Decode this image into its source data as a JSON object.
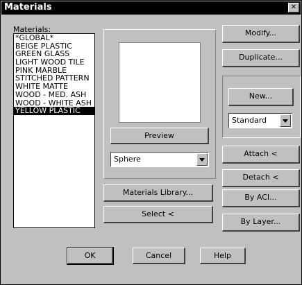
{
  "window": {
    "title": "Materials",
    "close_glyph": "✕"
  },
  "materials_label": "Materials:",
  "materials": [
    "*GLOBAL*",
    "BEIGE PLASTIC",
    "GREEN GLASS",
    "LIGHT WOOD TILE",
    "PINK MARBLE",
    "STITCHED PATTERN",
    "WHITE MATTE",
    "WOOD - MED. ASH",
    "WOOD - WHITE ASH",
    "YELLOW PLASTIC"
  ],
  "selected_material": "YELLOW PLASTIC",
  "preview": {
    "button_label": "Preview",
    "shape_value": "Sphere"
  },
  "buttons": {
    "materials_library": "Materials Library...",
    "select": "Select <",
    "modify": "Modify...",
    "duplicate": "Duplicate...",
    "new": "New...",
    "attach": "Attach <",
    "detach": "Detach <",
    "by_aci": "By ACI...",
    "by_layer": "By Layer...",
    "ok": "OK",
    "cancel": "Cancel",
    "help": "Help"
  },
  "new_type_value": "Standard"
}
